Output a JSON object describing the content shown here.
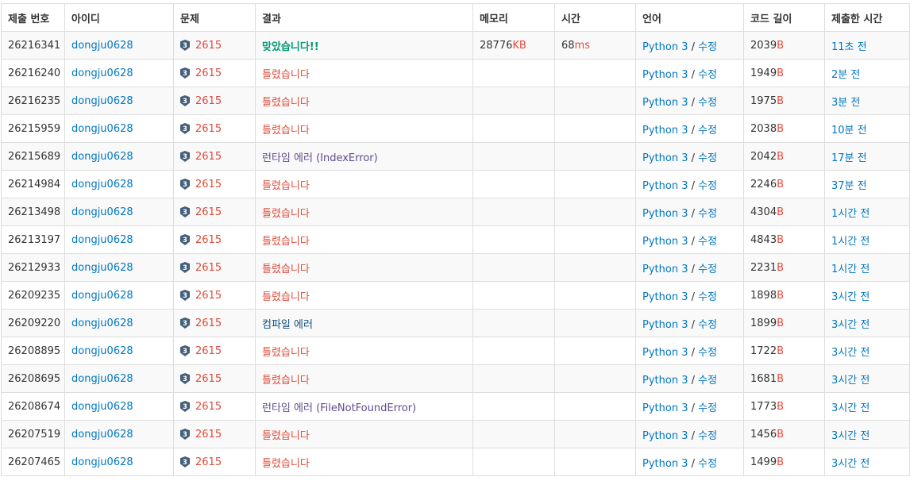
{
  "columns": [
    "제출 번호",
    "아이디",
    "문제",
    "결과",
    "메모리",
    "시간",
    "언어",
    "코드 길이",
    "제출한 시간"
  ],
  "colors": {
    "link": "#0076c0",
    "problem": "#dd4b39",
    "unit": "#e74c3c",
    "accepted": "#009874",
    "wrong": "#dd4b39",
    "runtime_error": "#5f4b8b",
    "compile_error": "#0f4c81",
    "tier_icon": "#435f7a"
  },
  "tier_icon_label": "3",
  "rows": [
    {
      "id": "26216341",
      "user": "dongju0628",
      "problem": "2615",
      "result": "맞았습니다!!",
      "result_type": "ac",
      "result_detail": "",
      "memory": "28776",
      "memory_unit": "KB",
      "time": "68",
      "time_unit": "ms",
      "lang": "Python 3",
      "edit": "수정",
      "code_len": "2039",
      "code_unit": "B",
      "when": "11초 전"
    },
    {
      "id": "26216240",
      "user": "dongju0628",
      "problem": "2615",
      "result": "틀렸습니다",
      "result_type": "wa",
      "result_detail": "",
      "memory": "",
      "memory_unit": "",
      "time": "",
      "time_unit": "",
      "lang": "Python 3",
      "edit": "수정",
      "code_len": "1949",
      "code_unit": "B",
      "when": "2분 전"
    },
    {
      "id": "26216235",
      "user": "dongju0628",
      "problem": "2615",
      "result": "틀렸습니다",
      "result_type": "wa",
      "result_detail": "",
      "memory": "",
      "memory_unit": "",
      "time": "",
      "time_unit": "",
      "lang": "Python 3",
      "edit": "수정",
      "code_len": "1975",
      "code_unit": "B",
      "when": "3분 전"
    },
    {
      "id": "26215959",
      "user": "dongju0628",
      "problem": "2615",
      "result": "틀렸습니다",
      "result_type": "wa",
      "result_detail": "",
      "memory": "",
      "memory_unit": "",
      "time": "",
      "time_unit": "",
      "lang": "Python 3",
      "edit": "수정",
      "code_len": "2038",
      "code_unit": "B",
      "when": "10분 전"
    },
    {
      "id": "26215689",
      "user": "dongju0628",
      "problem": "2615",
      "result": "런타임 에러",
      "result_type": "rte",
      "result_detail": "(IndexError)",
      "memory": "",
      "memory_unit": "",
      "time": "",
      "time_unit": "",
      "lang": "Python 3",
      "edit": "수정",
      "code_len": "2042",
      "code_unit": "B",
      "when": "17분 전"
    },
    {
      "id": "26214984",
      "user": "dongju0628",
      "problem": "2615",
      "result": "틀렸습니다",
      "result_type": "wa",
      "result_detail": "",
      "memory": "",
      "memory_unit": "",
      "time": "",
      "time_unit": "",
      "lang": "Python 3",
      "edit": "수정",
      "code_len": "2246",
      "code_unit": "B",
      "when": "37분 전"
    },
    {
      "id": "26213498",
      "user": "dongju0628",
      "problem": "2615",
      "result": "틀렸습니다",
      "result_type": "wa",
      "result_detail": "",
      "memory": "",
      "memory_unit": "",
      "time": "",
      "time_unit": "",
      "lang": "Python 3",
      "edit": "수정",
      "code_len": "4304",
      "code_unit": "B",
      "when": "1시간 전"
    },
    {
      "id": "26213197",
      "user": "dongju0628",
      "problem": "2615",
      "result": "틀렸습니다",
      "result_type": "wa",
      "result_detail": "",
      "memory": "",
      "memory_unit": "",
      "time": "",
      "time_unit": "",
      "lang": "Python 3",
      "edit": "수정",
      "code_len": "4843",
      "code_unit": "B",
      "when": "1시간 전"
    },
    {
      "id": "26212933",
      "user": "dongju0628",
      "problem": "2615",
      "result": "틀렸습니다",
      "result_type": "wa",
      "result_detail": "",
      "memory": "",
      "memory_unit": "",
      "time": "",
      "time_unit": "",
      "lang": "Python 3",
      "edit": "수정",
      "code_len": "2231",
      "code_unit": "B",
      "when": "1시간 전"
    },
    {
      "id": "26209235",
      "user": "dongju0628",
      "problem": "2615",
      "result": "틀렸습니다",
      "result_type": "wa",
      "result_detail": "",
      "memory": "",
      "memory_unit": "",
      "time": "",
      "time_unit": "",
      "lang": "Python 3",
      "edit": "수정",
      "code_len": "1898",
      "code_unit": "B",
      "when": "3시간 전"
    },
    {
      "id": "26209220",
      "user": "dongju0628",
      "problem": "2615",
      "result": "컴파일 에러",
      "result_type": "ce",
      "result_detail": "",
      "memory": "",
      "memory_unit": "",
      "time": "",
      "time_unit": "",
      "lang": "Python 3",
      "edit": "수정",
      "code_len": "1899",
      "code_unit": "B",
      "when": "3시간 전"
    },
    {
      "id": "26208895",
      "user": "dongju0628",
      "problem": "2615",
      "result": "틀렸습니다",
      "result_type": "wa",
      "result_detail": "",
      "memory": "",
      "memory_unit": "",
      "time": "",
      "time_unit": "",
      "lang": "Python 3",
      "edit": "수정",
      "code_len": "1722",
      "code_unit": "B",
      "when": "3시간 전"
    },
    {
      "id": "26208695",
      "user": "dongju0628",
      "problem": "2615",
      "result": "틀렸습니다",
      "result_type": "wa",
      "result_detail": "",
      "memory": "",
      "memory_unit": "",
      "time": "",
      "time_unit": "",
      "lang": "Python 3",
      "edit": "수정",
      "code_len": "1681",
      "code_unit": "B",
      "when": "3시간 전"
    },
    {
      "id": "26208674",
      "user": "dongju0628",
      "problem": "2615",
      "result": "런타임 에러",
      "result_type": "rte",
      "result_detail": "(FileNotFoundError)",
      "memory": "",
      "memory_unit": "",
      "time": "",
      "time_unit": "",
      "lang": "Python 3",
      "edit": "수정",
      "code_len": "1773",
      "code_unit": "B",
      "when": "3시간 전"
    },
    {
      "id": "26207519",
      "user": "dongju0628",
      "problem": "2615",
      "result": "틀렸습니다",
      "result_type": "wa",
      "result_detail": "",
      "memory": "",
      "memory_unit": "",
      "time": "",
      "time_unit": "",
      "lang": "Python 3",
      "edit": "수정",
      "code_len": "1456",
      "code_unit": "B",
      "when": "3시간 전"
    },
    {
      "id": "26207465",
      "user": "dongju0628",
      "problem": "2615",
      "result": "틀렸습니다",
      "result_type": "wa",
      "result_detail": "",
      "memory": "",
      "memory_unit": "",
      "time": "",
      "time_unit": "",
      "lang": "Python 3",
      "edit": "수정",
      "code_len": "1499",
      "code_unit": "B",
      "when": "3시간 전"
    }
  ]
}
